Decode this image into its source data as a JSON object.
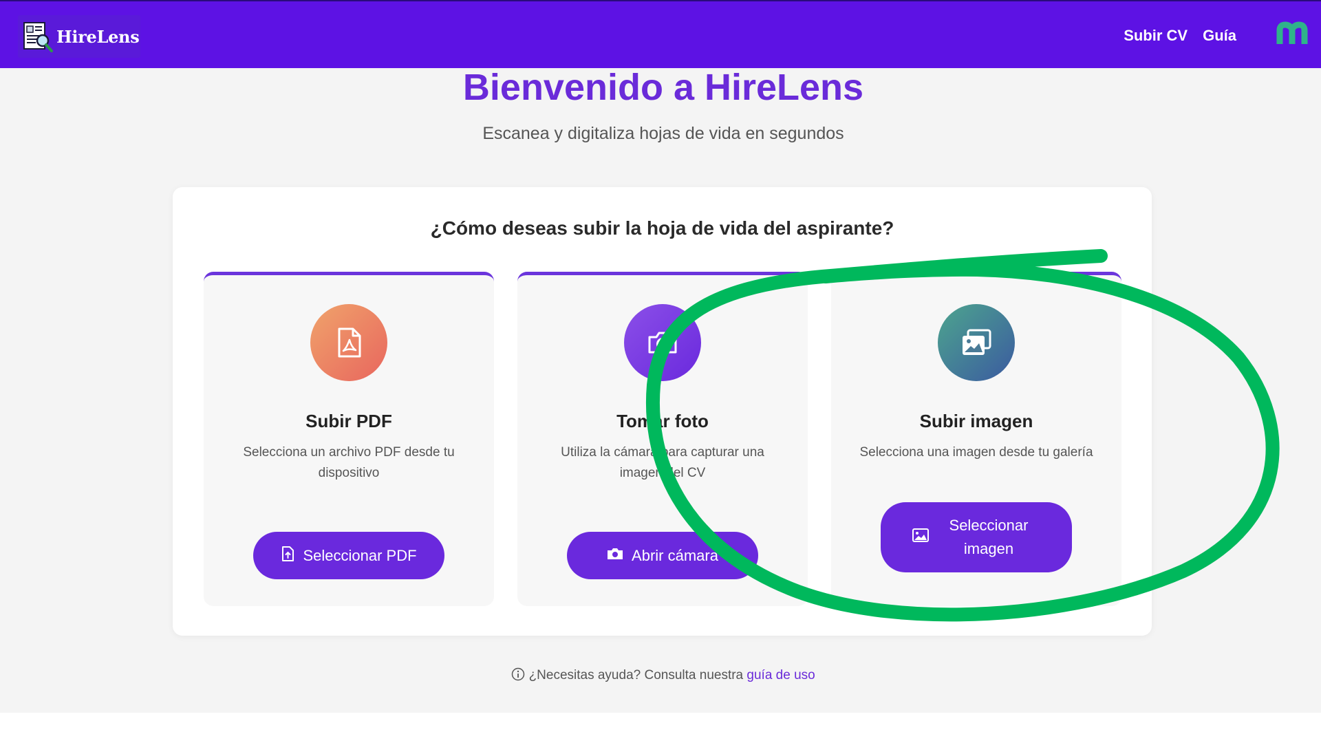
{
  "brand": {
    "name": "HireLens"
  },
  "nav": {
    "links": [
      "Subir CV",
      "Guía"
    ],
    "avatar_icon": "m-logo-icon"
  },
  "hero": {
    "title": "Bienvenido a HireLens",
    "subtitle": "Escanea y digitaliza hojas de vida en segundos"
  },
  "upload": {
    "question": "¿Cómo deseas subir la hoja de vida del aspirante?",
    "options": [
      {
        "title": "Subir PDF",
        "description": "Selecciona un archivo PDF desde tu dispositivo",
        "button": "Seleccionar PDF",
        "icon": "pdf-file-icon"
      },
      {
        "title": "Tomar foto",
        "description": "Utiliza la cámara para capturar una imagen del CV",
        "button": "Abrir cámara",
        "icon": "camera-icon"
      },
      {
        "title": "Subir imagen",
        "description": "Selecciona una imagen desde tu galería",
        "button": "Seleccionar imagen",
        "icon": "images-icon"
      }
    ]
  },
  "help": {
    "text": "¿Necesitas ayuda? Consulta nuestra",
    "link": "guía de uso"
  },
  "colors": {
    "navbar": "#5d12e4",
    "accent": "#6a29dd",
    "title": "#6a2bd9",
    "pdf_gradient": [
      "#f0a36b",
      "#e8665e"
    ],
    "camera_gradient": [
      "#8b4fe8",
      "#6a29dd"
    ],
    "image_gradient": [
      "#4da58e",
      "#3b5aa0"
    ],
    "annotation": "#00b85c"
  }
}
